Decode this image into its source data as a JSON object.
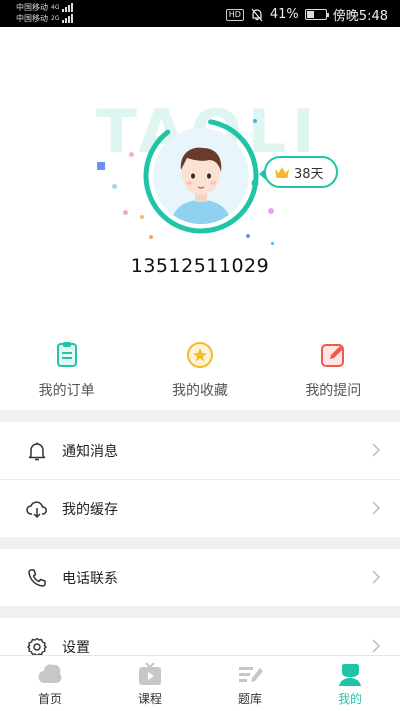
{
  "status_bar": {
    "carrier_1": "中国移动",
    "carrier_1_net": "4G",
    "carrier_2": "中国移动",
    "carrier_2_net": "2G",
    "hd": "HD",
    "battery": "41%",
    "battery_level": 0.41,
    "time": "傍晚5:48"
  },
  "profile": {
    "watermark": "TAOLI",
    "vip_days": "38天",
    "phone": "13512511029"
  },
  "shortcuts": [
    {
      "label": "我的订单",
      "icon": "order-clipboard-icon",
      "color": "#1fc5a6"
    },
    {
      "label": "我的收藏",
      "icon": "star-coin-icon",
      "color": "#f5b82e"
    },
    {
      "label": "我的提问",
      "icon": "edit-question-icon",
      "color": "#f05a4a"
    }
  ],
  "menu": [
    {
      "label": "通知消息",
      "icon": "bell-icon"
    },
    {
      "label": "我的缓存",
      "icon": "cloud-download-icon"
    },
    {
      "label": "电话联系",
      "icon": "phone-icon"
    },
    {
      "label": "设置",
      "icon": "gear-icon"
    }
  ],
  "tabs": [
    {
      "label": "首页",
      "icon": "home-icon",
      "active": false
    },
    {
      "label": "课程",
      "icon": "course-play-icon",
      "active": false
    },
    {
      "label": "题库",
      "icon": "question-bank-icon",
      "active": false
    },
    {
      "label": "我的",
      "icon": "profile-icon",
      "active": true
    }
  ],
  "colors": {
    "accent": "#1fc5a6",
    "gold": "#f5b82e",
    "red": "#f05a4a"
  }
}
